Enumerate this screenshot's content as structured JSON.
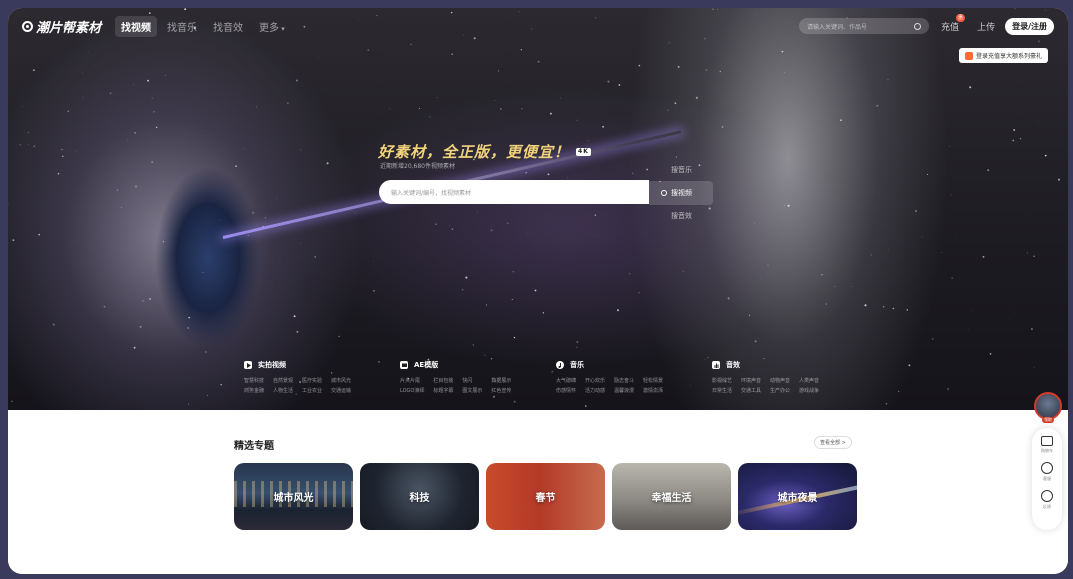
{
  "nav": {
    "logo": "潮片帮素材",
    "tabs": [
      "找视频",
      "找音乐",
      "找音效"
    ],
    "more": "更多",
    "search_placeholder": "请输入关键词、作品号",
    "recharge": "充值",
    "recharge_badge": "惠",
    "upload": "上传",
    "login": "登录/注册",
    "promo": "登录充值享大额系列豪礼"
  },
  "hero": {
    "slogan": "好素材，全正版，更便宜！",
    "badge": "4K",
    "subtitle": "近期新增20,680件视频素材",
    "search_placeholder": "输入关键词/编号，找视频素材",
    "search_options": [
      "搜音乐",
      "搜视频",
      "搜音效"
    ],
    "active_option_index": 1
  },
  "categories": [
    {
      "title": "实拍视频",
      "icon": "video-icon",
      "color": "#ffffff",
      "links": [
        "智慧科技",
        "自然景观",
        "医疗实验",
        "城市风光",
        "商务金融",
        "人物生活",
        "工业农业",
        "交通运输"
      ]
    },
    {
      "title": "AE模版",
      "icon": "folder-icon",
      "color": "#ffffff",
      "links": [
        "片头片尾",
        "栏目包装",
        "快闪",
        "数据展示",
        "LOGO演绎",
        "标题字幕",
        "图文展示",
        "红色宣传"
      ]
    },
    {
      "title": "音乐",
      "icon": "music-icon",
      "color": "#ffffff",
      "links": [
        "大气磅礴",
        "开心欢乐",
        "励志奋斗",
        "轻松情景",
        "伤感情怀",
        "活力动感",
        "温馨浪漫",
        "激情澎湃"
      ]
    },
    {
      "title": "音效",
      "icon": "sound-icon",
      "color": "#ffffff",
      "links": [
        "影视综艺",
        "环境声音",
        "动物声音",
        "人类声音",
        "日常生活",
        "交通工具",
        "生产办公",
        "游戏战争"
      ]
    }
  ],
  "featured": {
    "title": "精选专题",
    "view_all": "查看全部 >",
    "topics": [
      "城市风光",
      "科技",
      "春节",
      "幸福生活",
      "城市夜景"
    ]
  },
  "float_bar": {
    "avatar_tag": "领取",
    "items": [
      {
        "icon": "cart-icon",
        "label": "购物车"
      },
      {
        "icon": "headset-icon",
        "label": "客服"
      },
      {
        "icon": "chat-icon",
        "label": "反馈"
      }
    ]
  }
}
